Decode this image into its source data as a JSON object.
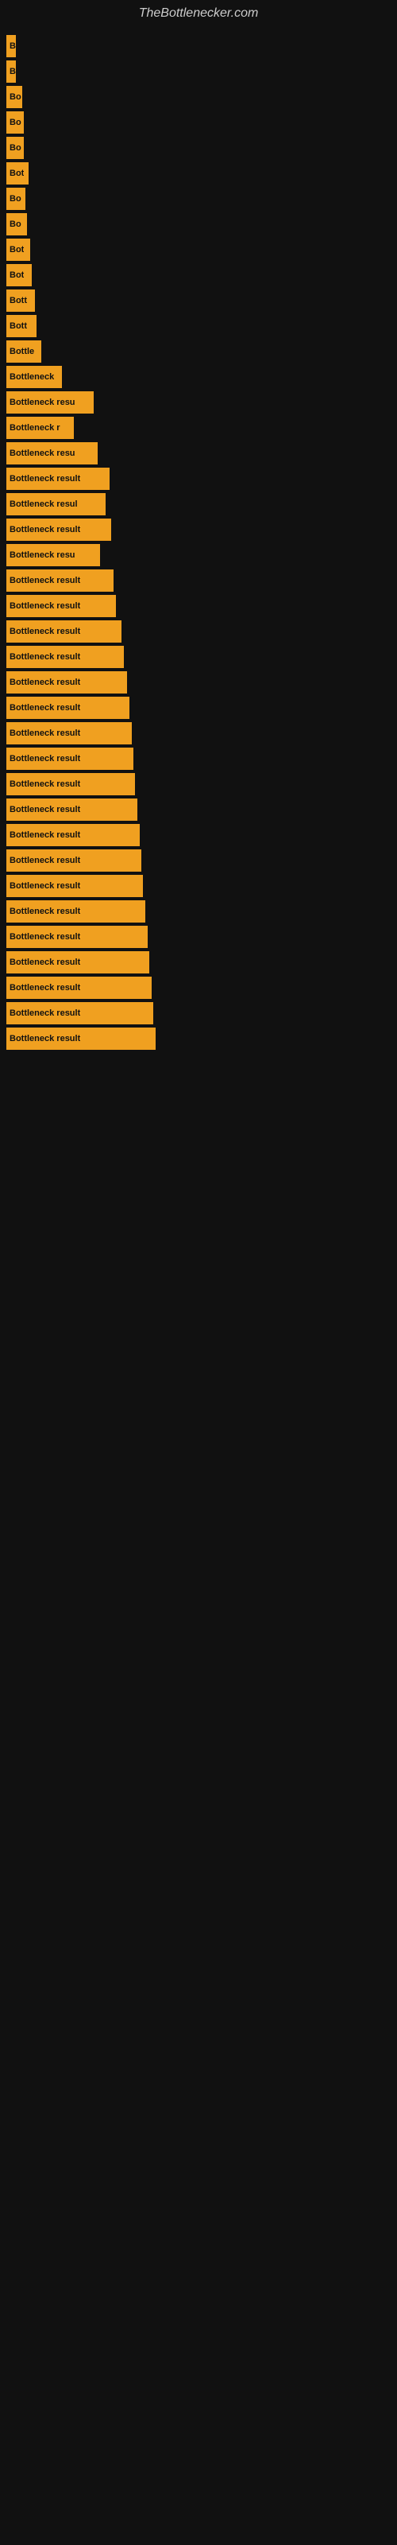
{
  "site": {
    "title": "TheBottlenecker.com"
  },
  "bars": [
    {
      "label": "B",
      "width": 12
    },
    {
      "label": "B",
      "width": 12
    },
    {
      "label": "Bo",
      "width": 20
    },
    {
      "label": "Bo",
      "width": 22
    },
    {
      "label": "Bo",
      "width": 22
    },
    {
      "label": "Bot",
      "width": 28
    },
    {
      "label": "Bo",
      "width": 24
    },
    {
      "label": "Bo",
      "width": 26
    },
    {
      "label": "Bot",
      "width": 30
    },
    {
      "label": "Bot",
      "width": 32
    },
    {
      "label": "Bott",
      "width": 36
    },
    {
      "label": "Bott",
      "width": 38
    },
    {
      "label": "Bottle",
      "width": 44
    },
    {
      "label": "Bottleneck",
      "width": 70
    },
    {
      "label": "Bottleneck resu",
      "width": 110
    },
    {
      "label": "Bottleneck r",
      "width": 85
    },
    {
      "label": "Bottleneck resu",
      "width": 115
    },
    {
      "label": "Bottleneck result",
      "width": 130
    },
    {
      "label": "Bottleneck resul",
      "width": 125
    },
    {
      "label": "Bottleneck result",
      "width": 132
    },
    {
      "label": "Bottleneck resu",
      "width": 118
    },
    {
      "label": "Bottleneck result",
      "width": 135
    },
    {
      "label": "Bottleneck result",
      "width": 138
    },
    {
      "label": "Bottleneck result",
      "width": 145
    },
    {
      "label": "Bottleneck result",
      "width": 148
    },
    {
      "label": "Bottleneck result",
      "width": 152
    },
    {
      "label": "Bottleneck result",
      "width": 155
    },
    {
      "label": "Bottleneck result",
      "width": 158
    },
    {
      "label": "Bottleneck result",
      "width": 160
    },
    {
      "label": "Bottleneck result",
      "width": 162
    },
    {
      "label": "Bottleneck result",
      "width": 165
    },
    {
      "label": "Bottleneck result",
      "width": 168
    },
    {
      "label": "Bottleneck result",
      "width": 170
    },
    {
      "label": "Bottleneck result",
      "width": 172
    },
    {
      "label": "Bottleneck result",
      "width": 175
    },
    {
      "label": "Bottleneck result",
      "width": 178
    },
    {
      "label": "Bottleneck result",
      "width": 180
    },
    {
      "label": "Bottleneck result",
      "width": 183
    },
    {
      "label": "Bottleneck result",
      "width": 185
    },
    {
      "label": "Bottleneck result",
      "width": 188
    }
  ]
}
